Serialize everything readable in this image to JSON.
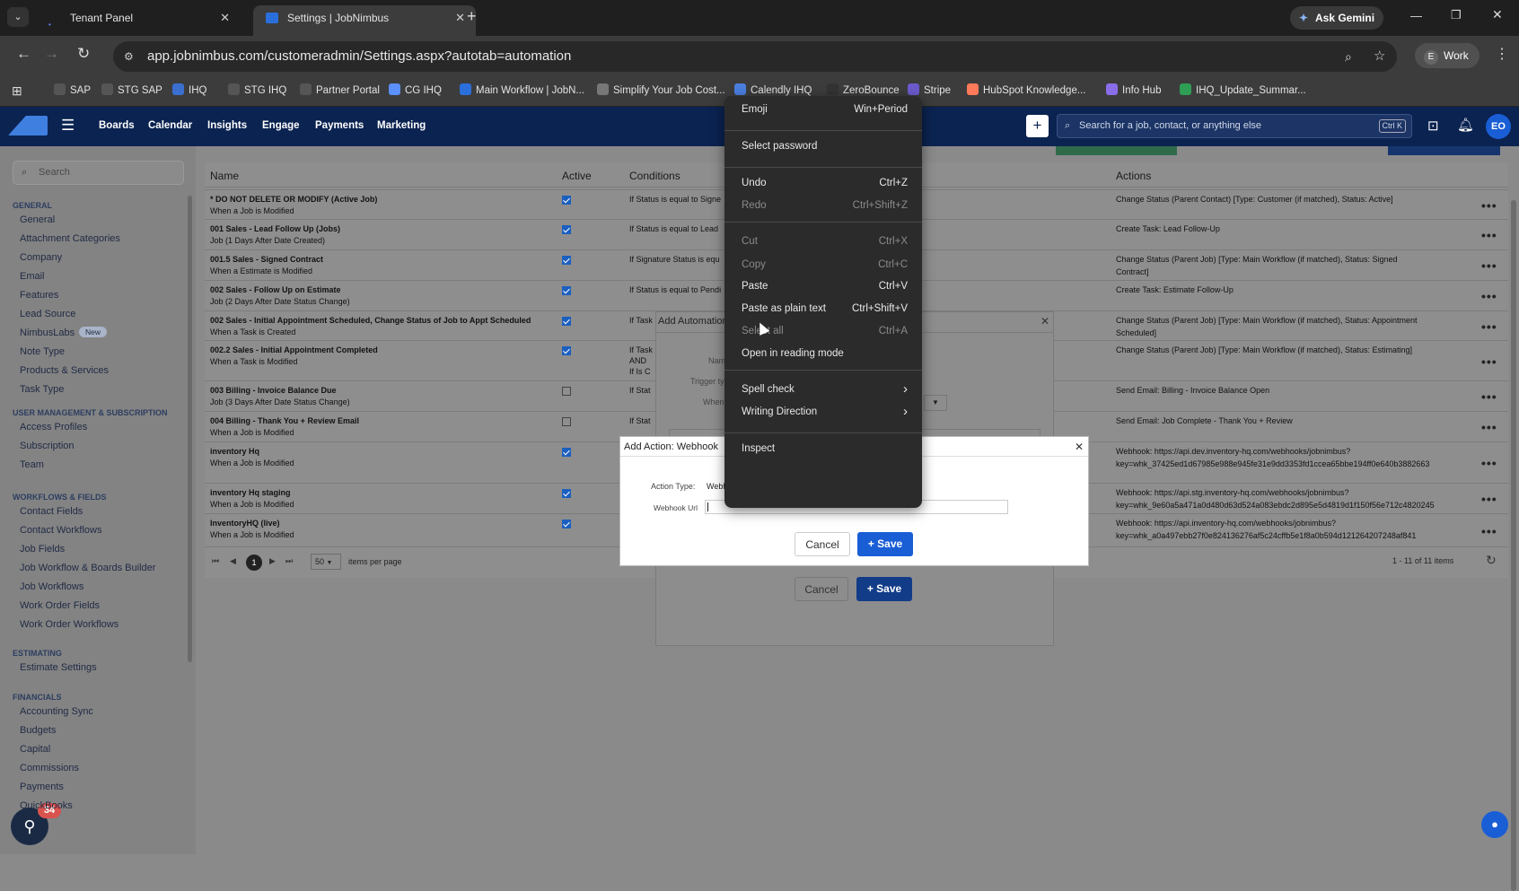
{
  "browser": {
    "tabs": [
      {
        "title": "Tenant Panel"
      },
      {
        "title": "Settings | JobNimbus"
      }
    ],
    "ask_gemini": "Ask Gemini",
    "url": "app.jobnimbus.com/customeradmin/Settings.aspx?autotab=automation",
    "profile": "Work",
    "profile_initial": "E",
    "bookmarks": [
      "SAP",
      "STG SAP",
      "IHQ",
      "STG IHQ",
      "Partner Portal",
      "CG IHQ",
      "Main Workflow | JobN...",
      "Simplify Your Job Cost...",
      "Calendly IHQ",
      "ZeroBounce",
      "Stripe",
      "HubSpot Knowledge...",
      "Info Hub",
      "IHQ_Update_Summar..."
    ]
  },
  "app": {
    "nav": [
      "Boards",
      "Calendar",
      "Insights",
      "Engage",
      "Payments",
      "Marketing"
    ],
    "search_placeholder": "Search for a job, contact, or anything else",
    "search_shortcut": "Ctrl K",
    "avatar": "EO"
  },
  "sidebar": {
    "search_placeholder": "Search",
    "sections": [
      {
        "header": "GENERAL",
        "items": [
          "General",
          "Attachment Categories",
          "Company",
          "Email",
          "Features",
          "Lead Source",
          "NimbusLabs",
          "Note Type",
          "Products & Services",
          "Task Type"
        ]
      },
      {
        "header": "USER MANAGEMENT & SUBSCRIPTION",
        "items": [
          "Access Profiles",
          "Subscription",
          "Team"
        ]
      },
      {
        "header": "WORKFLOWS & FIELDS",
        "items": [
          "Contact Fields",
          "Contact Workflows",
          "Job Fields",
          "Job Workflow & Boards Builder",
          "Job Workflows",
          "Work Order Fields",
          "Work Order Workflows"
        ]
      },
      {
        "header": "ESTIMATING",
        "items": [
          "Estimate Settings"
        ]
      },
      {
        "header": "FINANCIALS",
        "items": [
          "Accounting Sync",
          "Budgets",
          "Capital",
          "Commissions",
          "Payments",
          "QuickBooks"
        ]
      }
    ],
    "new_badge": "New",
    "help_count": "34"
  },
  "grid": {
    "columns": [
      "Name",
      "Active",
      "Conditions",
      "Actions"
    ],
    "rows": [
      {
        "name": "* DO NOT DELETE OR MODIFY (Active Job)",
        "sub": "When a Job is Modified",
        "active": true,
        "cond": "If Status is equal to Signe",
        "action": "Change Status (Parent Contact) [Type: Customer (if matched), Status: Active]"
      },
      {
        "name": "001 Sales - Lead Follow Up (Jobs)",
        "sub": "Job (1 Days After Date Created)",
        "active": true,
        "cond": "If Status is equal to Lead",
        "action": "Create Task: Lead Follow-Up"
      },
      {
        "name": "001.5 Sales - Signed Contract",
        "sub": "When a Estimate is Modified",
        "active": true,
        "cond": "If Signature Status is equ",
        "action": "Change Status (Parent Job) [Type: Main Workflow (if matched), Status: Signed Contract]"
      },
      {
        "name": "002 Sales - Follow Up on Estimate",
        "sub": "Job (2 Days After Date Status Change)",
        "active": true,
        "cond": "If Status is equal to Pendi",
        "action": "Create Task: Estimate Follow-Up"
      },
      {
        "name": "002 Sales - Initial Appointment Scheduled, Change Status of Job to Appt Scheduled",
        "sub": "When a Task is Created",
        "active": true,
        "cond": "If Task",
        "action": "Change Status (Parent Job) [Type: Main Workflow (if matched), Status: Appointment Scheduled]"
      },
      {
        "name": "002.2 Sales - Initial Appointment Completed",
        "sub": "When a Task is Modified",
        "active": true,
        "cond": "If Task",
        "action": "Change Status (Parent Job) [Type: Main Workflow (if matched), Status: Estimating]"
      },
      {
        "name": "003 Billing - Invoice Balance Due",
        "sub": "Job (3 Days After Date Status Change)",
        "active": false,
        "cond": "If Stat",
        "action": "Send Email: Billing - Invoice Balance Open"
      },
      {
        "name": "004 Billing - Thank You + Review Email",
        "sub": "When a Job is Modified",
        "active": false,
        "cond": "If Stat",
        "action": "Send Email: Job Complete - Thank You + Review"
      },
      {
        "name": "inventory Hq",
        "sub": "When a Job is Modified",
        "active": true,
        "cond": "",
        "action": "Webhook: https://api.dev.inventory-hq.com/webhooks/jobnimbus?key=whk_37425ed1d67985e988e945fe31e9dd3353fd1ccea65bbe194ff0e640b3882663"
      },
      {
        "name": "inventory Hq staging",
        "sub": "When a Job is Modified",
        "active": true,
        "cond": "",
        "action": "Webhook: https://api.stg.inventory-hq.com/webhooks/jobnimbus?key=whk_9e60a5a471a0d480d63d524a083ebdc2d895e5d4819d1f150f56e712c4820245"
      },
      {
        "name": "InventoryHQ (live)",
        "sub": "When a Job is Modified",
        "active": true,
        "cond": "",
        "action": "Webhook: https://api.inventory-hq.com/webhooks/jobnimbus?key=whk_a0a497ebb27f0e824136276af5c24cffb5e1f8a0b594d121264207248af841"
      }
    ],
    "extra_cond_row6": "AND",
    "extra_cond_row6b": "If Is C",
    "pager": {
      "page": "1",
      "per_page": "50",
      "per_page_label": "items per page",
      "summary": "1 - 11 of 11 items"
    }
  },
  "automation_modal": {
    "title": "Add Automation",
    "label_name": "Nam",
    "label_trigger": "Trigger typ",
    "label_when": "When",
    "cancel": "Cancel",
    "save": "+ Save"
  },
  "webhook_modal": {
    "title": "Add Action: Webhook",
    "action_type_label": "Action Type:",
    "action_type_value": "Webh",
    "url_label": "Webhook Url",
    "url_value": "",
    "cancel": "Cancel",
    "save": "+ Save"
  },
  "context_menu": {
    "items": [
      {
        "label": "Emoji",
        "shortcut": "Win+Period",
        "disabled": false
      },
      {
        "label": "Select password",
        "shortcut": "",
        "disabled": false
      },
      {
        "label": "Undo",
        "shortcut": "Ctrl+Z",
        "disabled": false
      },
      {
        "label": "Redo",
        "shortcut": "Ctrl+Shift+Z",
        "disabled": true
      },
      {
        "label": "Cut",
        "shortcut": "Ctrl+X",
        "disabled": true
      },
      {
        "label": "Copy",
        "shortcut": "Ctrl+C",
        "disabled": true
      },
      {
        "label": "Paste",
        "shortcut": "Ctrl+V",
        "disabled": false
      },
      {
        "label": "Paste as plain text",
        "shortcut": "Ctrl+Shift+V",
        "disabled": false
      },
      {
        "label": "Select all",
        "shortcut": "Ctrl+A",
        "disabled": true
      },
      {
        "label": "Open in reading mode",
        "shortcut": "",
        "disabled": false
      },
      {
        "label": "Spell check",
        "shortcut": "",
        "disabled": false
      },
      {
        "label": "Writing Direction",
        "shortcut": "",
        "disabled": false
      },
      {
        "label": "Inspect",
        "shortcut": "",
        "disabled": false
      }
    ]
  },
  "colors": {
    "app_header": "#0b2351",
    "primary": "#1a5ed6",
    "menu_bg": "#2b2b2b"
  }
}
